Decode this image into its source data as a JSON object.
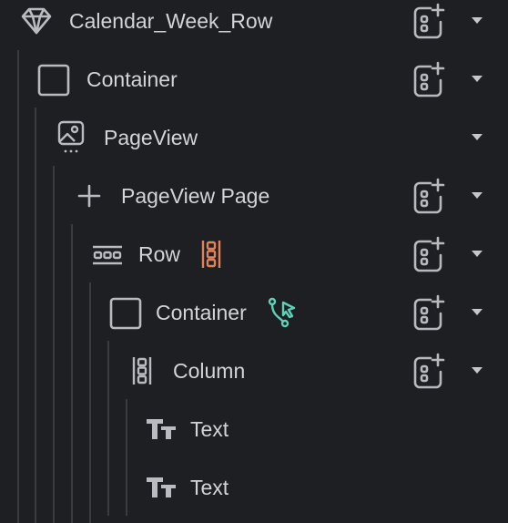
{
  "colors": {
    "background": "#1e1f22",
    "text": "#d2d4d8",
    "guide": "#3a3c41",
    "row_badge": "#e0835a",
    "action_badge": "#5fd1b7"
  },
  "tree": {
    "items": [
      {
        "label": "Calendar_Week_Row",
        "icon": "component-diamond-icon"
      },
      {
        "label": "Container",
        "icon": "container-square-icon"
      },
      {
        "label": "PageView",
        "icon": "pageview-image-icon"
      },
      {
        "label": "PageView Page",
        "icon": "plus-icon"
      },
      {
        "label": "Row",
        "icon": "row-icon",
        "badge": "column-layout-badge-icon"
      },
      {
        "label": "Container",
        "icon": "container-square-icon",
        "badge": "action-cursor-badge-icon"
      },
      {
        "label": "Column",
        "icon": "column-icon"
      },
      {
        "label": "Text",
        "icon": "text-icon"
      },
      {
        "label": "Text",
        "icon": "text-icon"
      }
    ]
  }
}
